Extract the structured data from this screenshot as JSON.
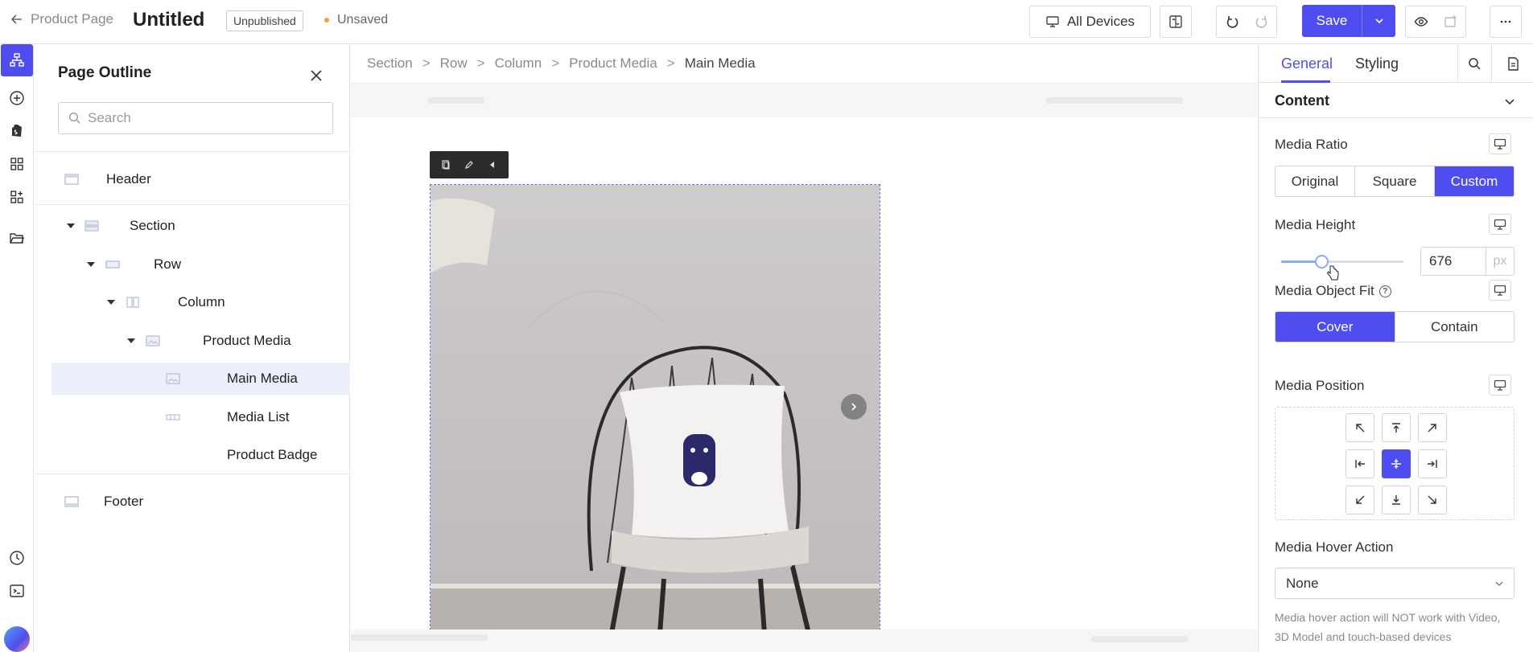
{
  "topbar": {
    "back_label": "Product Page",
    "title": "Untitled",
    "status_badge": "Unpublished",
    "unsaved_label": "Unsaved",
    "devices_label": "All Devices",
    "save_label": "Save"
  },
  "outline": {
    "title": "Page Outline",
    "search_placeholder": "Search",
    "tree": {
      "header": "Header",
      "section": "Section",
      "row": "Row",
      "column": "Column",
      "product_media": "Product Media",
      "main_media": "Main Media",
      "media_list": "Media List",
      "product_badge": "Product Badge",
      "footer": "Footer"
    }
  },
  "breadcrumb": {
    "items": [
      "Section",
      "Row",
      "Column",
      "Product Media"
    ],
    "separator": ">",
    "current": "Main Media"
  },
  "inspector": {
    "tabs": [
      "General",
      "Styling"
    ],
    "active_tab": "General",
    "section_title": "Content",
    "media_ratio": {
      "label": "Media Ratio",
      "options": [
        "Original",
        "Square",
        "Custom"
      ],
      "selected": "Custom"
    },
    "media_height": {
      "label": "Media Height",
      "value": "676",
      "unit": "px",
      "slider_fraction": 0.33
    },
    "media_object_fit": {
      "label": "Media Object Fit",
      "options": [
        "Cover",
        "Contain"
      ],
      "selected": "Cover"
    },
    "media_position": {
      "label": "Media Position",
      "selected": "center"
    },
    "media_hover_action": {
      "label": "Media Hover Action",
      "value": "None",
      "help": "Media hover action will NOT work with Video, 3D Model and touch-based devices"
    }
  },
  "colors": {
    "accent": "#4e4ef0",
    "selected_row": "#eceef9",
    "unsaved_dot": "#f0a33a"
  }
}
